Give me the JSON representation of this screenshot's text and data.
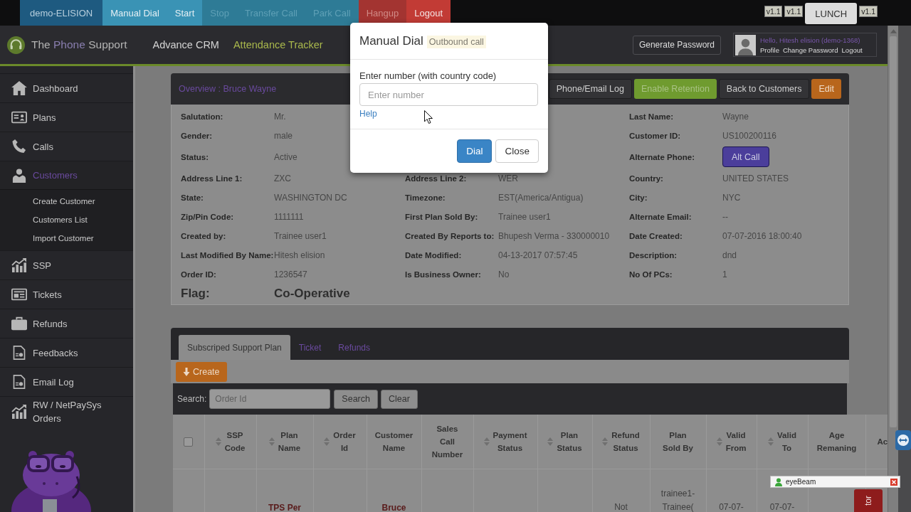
{
  "topbar": {
    "buttons": [
      {
        "label": "demo-ELISION",
        "kind": "account",
        "disabled": false
      },
      {
        "label": "Manual Dial",
        "kind": "call",
        "disabled": false
      },
      {
        "label": "Start",
        "kind": "call",
        "disabled": false
      },
      {
        "label": "Stop",
        "kind": "call",
        "disabled": true
      },
      {
        "label": "Transfer Call",
        "kind": "call",
        "disabled": true
      },
      {
        "label": "Park Call",
        "kind": "call",
        "disabled": true
      },
      {
        "label": "Hangup",
        "kind": "danger",
        "disabled": true
      },
      {
        "label": "Logout",
        "kind": "danger",
        "disabled": false
      }
    ],
    "right_items": [
      {
        "label": "v1.1",
        "kind": "badge"
      },
      {
        "label": "v1.1",
        "kind": "badge"
      },
      {
        "label": "LUNCH",
        "kind": "button"
      },
      {
        "label": "v1.1",
        "kind": "badge"
      }
    ]
  },
  "header": {
    "logo": [
      {
        "text": "The",
        "accent": false
      },
      {
        "text": "Phone",
        "accent": true
      },
      {
        "text": "Support",
        "accent": false
      }
    ],
    "nav": [
      {
        "label": "Advance CRM",
        "selected": false
      },
      {
        "label": "Attendance Tracker",
        "selected": true
      }
    ],
    "generate_password": "Generate Password",
    "user": {
      "greeting": "Hello, Hitesh elision (demo-1368)",
      "links": [
        "Profile",
        "Change Password",
        "Logout"
      ]
    }
  },
  "sidebar": {
    "items": [
      {
        "label": "Dashboard",
        "selected": false
      },
      {
        "label": "Plans",
        "selected": false
      },
      {
        "label": "Calls",
        "selected": false
      },
      {
        "label": "Customers",
        "selected": true,
        "expanded": true,
        "children": [
          {
            "label": "Create Customer"
          },
          {
            "label": "Customers List"
          },
          {
            "label": "Import Customer"
          }
        ]
      },
      {
        "label": "SSP",
        "selected": false
      },
      {
        "label": "Tickets",
        "selected": false
      },
      {
        "label": "Refunds",
        "selected": false
      },
      {
        "label": "Feedbacks",
        "selected": false
      },
      {
        "label": "Email Log",
        "selected": false
      },
      {
        "label": "RW / NetPaySys Orders",
        "selected": false
      }
    ]
  },
  "overview": {
    "title": "Overview : Bruce Wayne",
    "actions": [
      {
        "label": "Phone/Email Log",
        "kind": "dark",
        "disabled": false
      },
      {
        "label": "Enable Retention",
        "kind": "success",
        "disabled": true
      },
      {
        "label": "Back to Customers",
        "kind": "dark",
        "disabled": false
      },
      {
        "label": "Edit",
        "kind": "warning",
        "disabled": false
      }
    ],
    "rows": [
      {
        "left": {
          "label": "Salutation:",
          "value": "Mr.",
          "kind": "text"
        },
        "right": {
          "label": "Last Name:",
          "value": "Wayne",
          "kind": "text"
        }
      },
      {
        "left": {
          "label": "Gender:",
          "value": "male",
          "kind": "text"
        },
        "right": {
          "label": "Customer ID:",
          "value": "US100200116",
          "kind": "text"
        }
      },
      {
        "left": {
          "label": "Status:",
          "value": "Active",
          "kind": "text"
        },
        "right": {
          "label": "Alternate Phone:",
          "value": "Alt Call",
          "kind": "button"
        }
      },
      {
        "left": {
          "label": "Address Line 1:",
          "value": "ZXC",
          "kind": "text"
        },
        "middle": {
          "label": "Address Line 2:",
          "value": "WER",
          "kind": "text"
        },
        "right": {
          "label": "Country:",
          "value": "UNITED STATES",
          "kind": "text"
        }
      },
      {
        "left": {
          "label": "State:",
          "value": "WASHINGTON DC",
          "kind": "text"
        },
        "middle": {
          "label": "Timezone:",
          "value": "EST(America/Antigua)",
          "kind": "text"
        },
        "right": {
          "label": "City:",
          "value": "NYC",
          "kind": "text"
        }
      },
      {
        "left": {
          "label": "Zip/Pin Code:",
          "value": "1111111",
          "kind": "text"
        },
        "middle": {
          "label": "First Plan Sold By:",
          "value": "Trainee user1",
          "kind": "text"
        },
        "right": {
          "label": "Alternate Email:",
          "value": "--",
          "kind": "text"
        }
      },
      {
        "left": {
          "label": "Created by:",
          "value": "Trainee user1",
          "kind": "text"
        },
        "middle": {
          "label": "Created By Reports to:",
          "value": "Bhupesh Verma - 330000010",
          "kind": "text"
        },
        "right": {
          "label": "Date Created:",
          "value": "07-07-2016 18:00:40",
          "kind": "text"
        }
      },
      {
        "left": {
          "label": "Last Modified By Name:",
          "value": "Hitesh elision",
          "kind": "text"
        },
        "middle": {
          "label": "Date Modified:",
          "value": "04-13-2017 07:57:45",
          "kind": "text"
        },
        "right": {
          "label": "Description:",
          "value": "dnd",
          "kind": "text"
        }
      },
      {
        "left": {
          "label": "Order ID:",
          "value": "1236547",
          "kind": "text"
        },
        "middle": {
          "label": "Is Business Owner:",
          "value": "No",
          "kind": "text"
        },
        "right": {
          "label": "No Of PCs:",
          "value": "1",
          "kind": "text"
        }
      }
    ],
    "flag": {
      "label": "Flag:",
      "value": "Co-Operative"
    }
  },
  "modal": {
    "title": "Manual Dial",
    "badge": "Outbound call",
    "field_label": "Enter number (with country code)",
    "placeholder": "Enter number",
    "help_link": "Help",
    "buttons": [
      {
        "label": "Dial",
        "kind": "primary"
      },
      {
        "label": "Close",
        "kind": "default"
      }
    ]
  },
  "subscriptions": {
    "tabs": [
      {
        "label": "Subscriped Support Plan",
        "selected": true
      },
      {
        "label": "Ticket",
        "selected": false
      },
      {
        "label": "Refunds",
        "selected": false
      }
    ],
    "create_button": "Create",
    "search": {
      "label": "Search:",
      "placeholder": "Order Id",
      "buttons": [
        "Search",
        "Clear"
      ]
    },
    "table": {
      "select_all": {
        "checked": false
      },
      "columns": [
        {
          "label": "SSP\nCode",
          "sortable": true
        },
        {
          "label": "Plan\nName",
          "sortable": true
        },
        {
          "label": "Order\nId",
          "sortable": true
        },
        {
          "label": "Customer\nName",
          "sortable": false
        },
        {
          "label": "Sales\nCall\nNumber",
          "sortable": false
        },
        {
          "label": "Payment\nStatus",
          "sortable": true
        },
        {
          "label": "Plan\nStatus",
          "sortable": true
        },
        {
          "label": "Refund\nStatus",
          "sortable": true
        },
        {
          "label": "Plan\nSold By",
          "sortable": false
        },
        {
          "label": "Valid\nFrom",
          "sortable": true
        },
        {
          "label": "Valid\nTo",
          "sortable": true
        },
        {
          "label": "Age\nRemaning",
          "sortable": false
        },
        {
          "label": "Ac",
          "sortable": false
        }
      ],
      "rows": [
        {
          "cells": [
            null,
            {
              "text": "TPS Per",
              "kind": "link"
            },
            null,
            {
              "text": "Bruce",
              "kind": "link"
            },
            null,
            null,
            null,
            {
              "text": "Not",
              "kind": "text"
            },
            {
              "text": "trainee1-Trainee(",
              "kind": "text"
            },
            {
              "text": "07-07-",
              "kind": "text"
            },
            {
              "text": "07-07-",
              "kind": "text"
            },
            null,
            null
          ]
        }
      ]
    }
  },
  "popups": {
    "eyebeam": {
      "title": "eyeBeam"
    },
    "side_tab": {
      "label": "tor"
    }
  }
}
